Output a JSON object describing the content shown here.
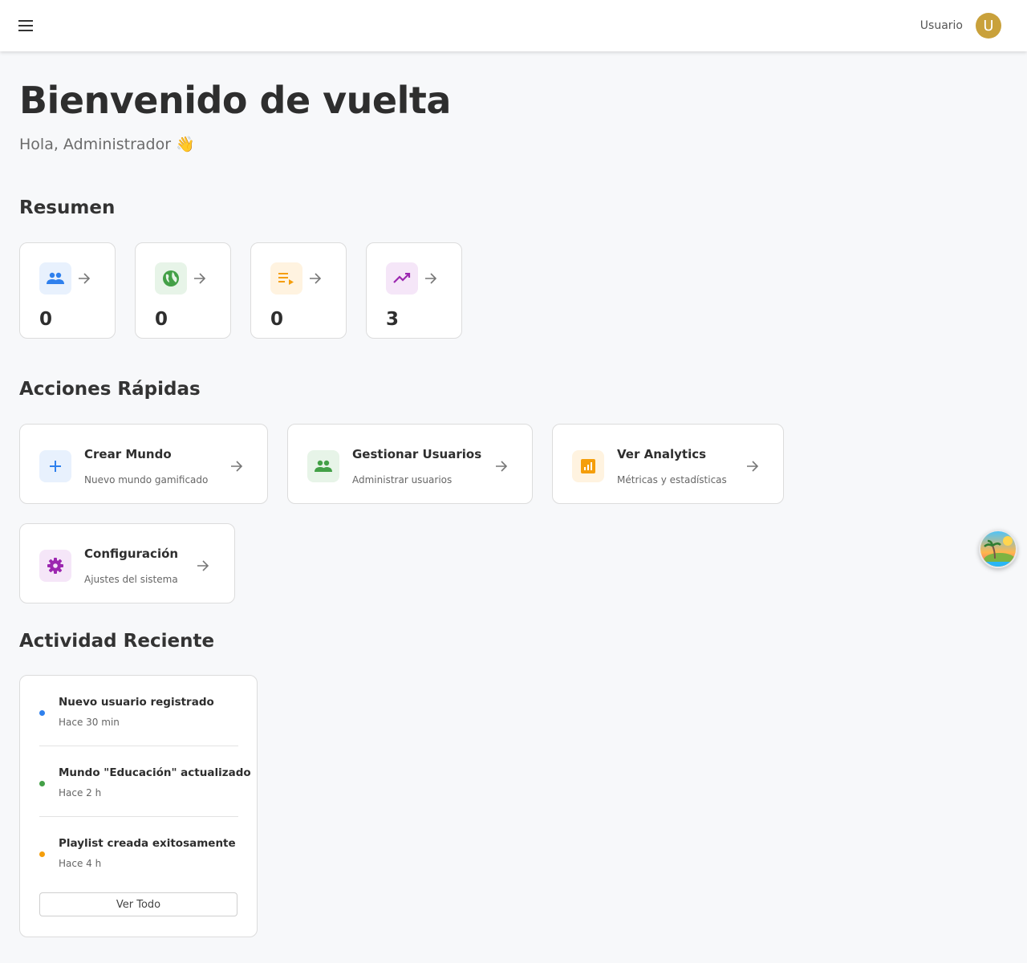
{
  "header": {
    "menu_icon": "menu-icon",
    "user_label": "Usuario",
    "avatar_letter": "U"
  },
  "hero": {
    "title": "Bienvenido de vuelta",
    "greeting": "Hola, Administrador 👋"
  },
  "summary": {
    "title": "Resumen",
    "stats": [
      {
        "icon": "people-icon",
        "value": "0",
        "accent": "#2f80ed"
      },
      {
        "icon": "globe-icon",
        "value": "0",
        "accent": "#43a047"
      },
      {
        "icon": "playlist-icon",
        "value": "0",
        "accent": "#f59e0b"
      },
      {
        "icon": "trending-up-icon",
        "value": "3",
        "accent": "#9c27b0"
      }
    ]
  },
  "quick_actions": {
    "title": "Acciones Rápidas",
    "items": [
      {
        "icon": "plus-icon",
        "title": "Crear Mundo",
        "subtitle": "Nuevo mundo gamificado"
      },
      {
        "icon": "people-icon",
        "title": "Gestionar Usuarios",
        "subtitle": "Administrar usuarios"
      },
      {
        "icon": "analytics-icon",
        "title": "Ver Analytics",
        "subtitle": "Métricas y estadísticas"
      },
      {
        "icon": "gear-icon",
        "title": "Configuración",
        "subtitle": "Ajustes del sistema"
      }
    ]
  },
  "recent_activity": {
    "title": "Actividad Reciente",
    "items": [
      {
        "title": "Nuevo usuario registrado",
        "time": "Hace 30 min",
        "dot_color": "#2f80ed"
      },
      {
        "title": "Mundo \"Educación\" actualizado",
        "time": "Hace 2 h",
        "dot_color": "#43a047"
      },
      {
        "title": "Playlist creada exitosamente",
        "time": "Hace 4 h",
        "dot_color": "#f59e0b"
      }
    ],
    "view_all_label": "Ver Todo"
  },
  "floating_button": {
    "icon": "island-avatar-icon"
  }
}
